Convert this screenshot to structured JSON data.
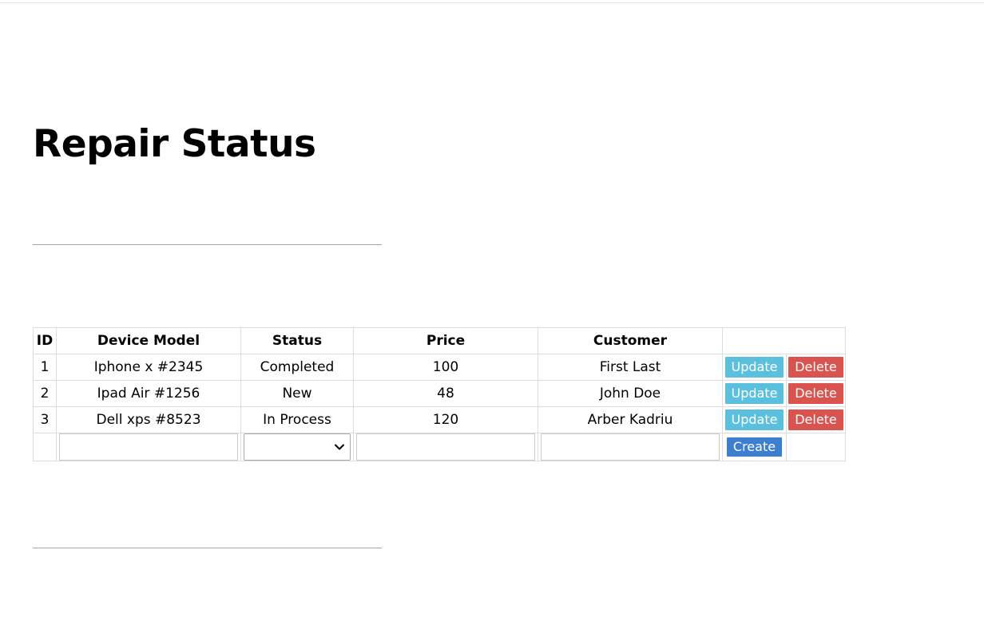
{
  "page": {
    "title": "Repair Status"
  },
  "table": {
    "headers": [
      "ID",
      "Device Model",
      "Status",
      "Price",
      "Customer",
      ""
    ],
    "rows": [
      {
        "id": "1",
        "device_model": "Iphone x #2345",
        "status": "Completed",
        "price": "100",
        "customer": "First Last"
      },
      {
        "id": "2",
        "device_model": "Ipad Air #1256",
        "status": "New",
        "price": "48",
        "customer": "John Doe"
      },
      {
        "id": "3",
        "device_model": "Dell xps #8523",
        "status": "In Process",
        "price": "120",
        "customer": "Arber Kadriu"
      }
    ],
    "update_label": "Update",
    "delete_label": "Delete"
  },
  "create_form": {
    "device_model_value": "",
    "status_selected": "",
    "price_value": "",
    "customer_value": "",
    "create_label": "Create"
  },
  "colors": {
    "update": "#5bc0de",
    "delete": "#d9534f",
    "create": "#3c7fd1",
    "border": "#dddddd"
  }
}
